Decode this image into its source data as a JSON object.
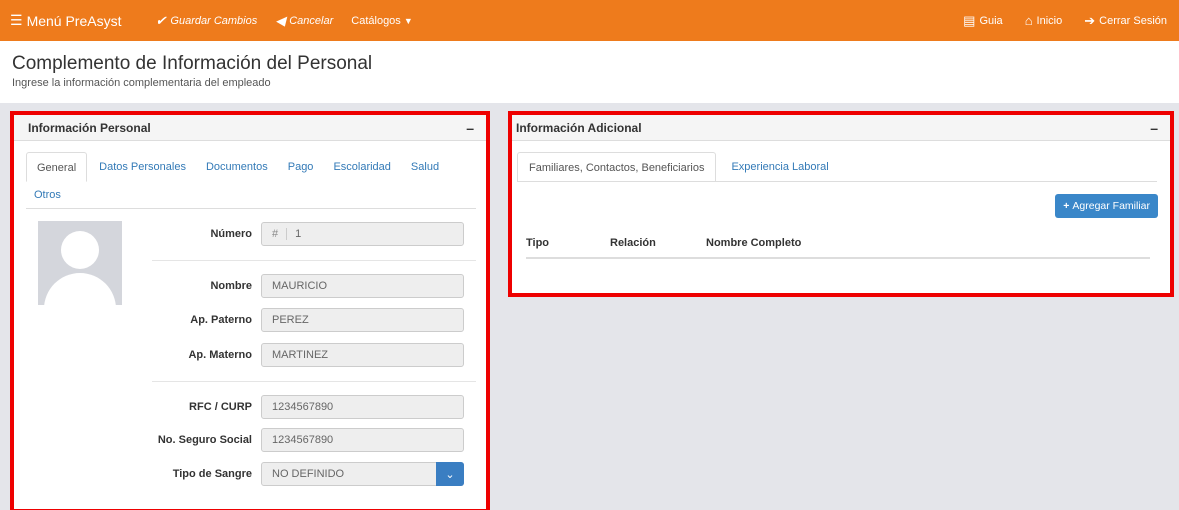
{
  "nav": {
    "brand": "Menú PreAsyst",
    "save": "Guardar Cambios",
    "cancel": "Cancelar",
    "catalogs": "Catálogos",
    "guide": "Guia",
    "home": "Inicio",
    "logout": "Cerrar Sesión"
  },
  "header": {
    "title": "Complemento de Información del Personal",
    "subtitle": "Ingrese la información complementaria del empleado"
  },
  "personal": {
    "title": "Información Personal",
    "collapse": "–",
    "tabs": [
      "General",
      "Datos Personales",
      "Documentos",
      "Pago",
      "Escolaridad",
      "Salud",
      "Otros"
    ],
    "fields": {
      "numero_label": "Número",
      "numero_prefix": "#",
      "numero_value": "1",
      "nombre_label": "Nombre",
      "nombre_value": "MAURICIO",
      "paterno_label": "Ap. Paterno",
      "paterno_value": "PEREZ",
      "materno_label": "Ap. Materno",
      "materno_value": "MARTINEZ",
      "rfc_label": "RFC / CURP",
      "rfc_value": "1234567890",
      "nss_label": "No. Seguro Social",
      "nss_value": "1234567890",
      "sangre_label": "Tipo de Sangre",
      "sangre_value": "NO DEFINIDO"
    }
  },
  "additional": {
    "title": "Información Adicional",
    "collapse": "–",
    "tabs": [
      "Familiares, Contactos, Beneficiarios",
      "Experiencia Laboral"
    ],
    "add_button": "Agregar Familiar",
    "columns": [
      "Tipo",
      "Relación",
      "Nombre Completo"
    ]
  },
  "colors": {
    "navbar": "#ee7b1c",
    "highlight": "#ee0000",
    "primary": "#3a7ec2"
  }
}
